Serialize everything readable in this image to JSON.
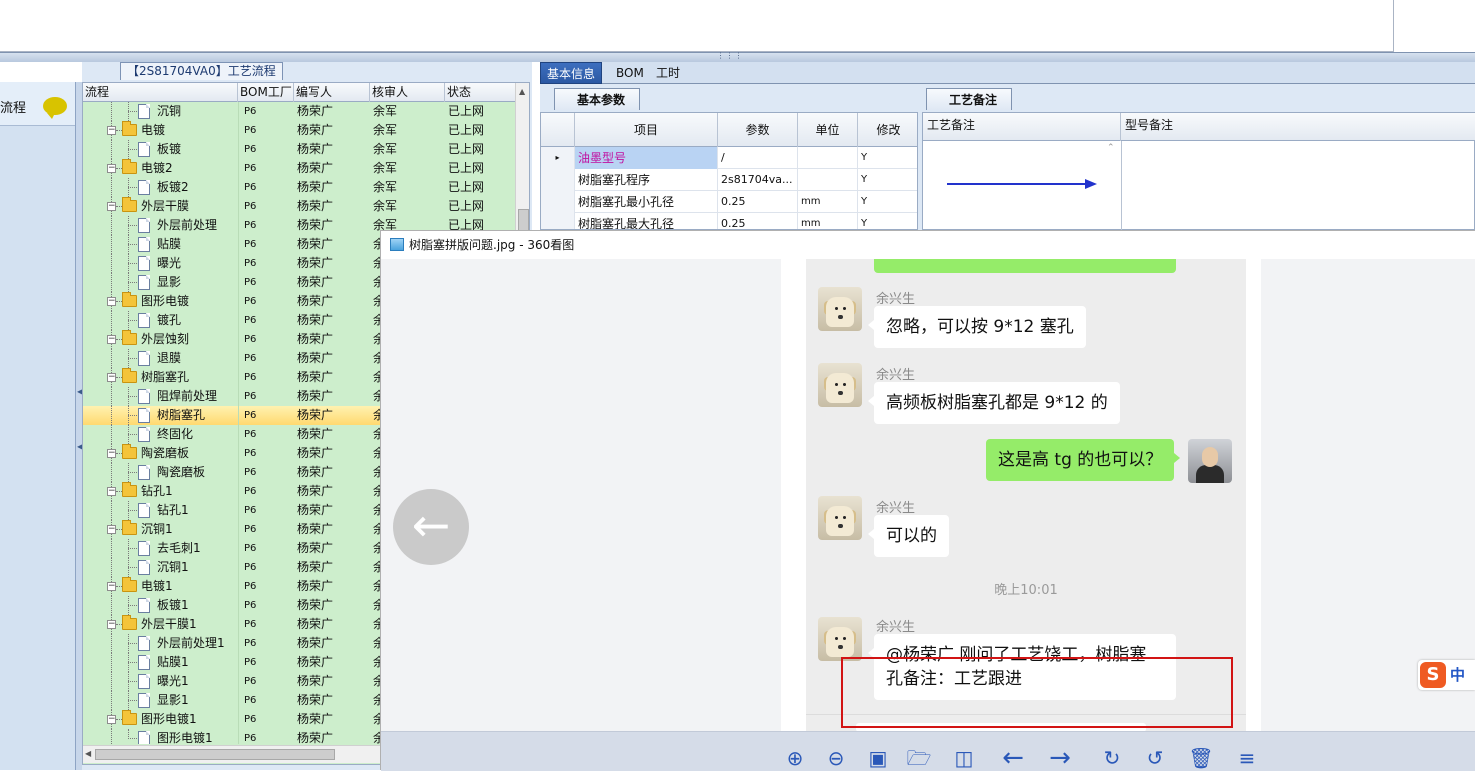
{
  "tree": {
    "title": "【2S81704VA0】工艺流程",
    "columns": [
      "流程",
      "BOM工厂",
      "编写人",
      "核审人",
      "状态"
    ],
    "rows": [
      {
        "level": 2,
        "type": "doc",
        "name": "沉铜",
        "factory": "P6",
        "writer": "杨荣广",
        "reviewer": "余军",
        "status": "已上网"
      },
      {
        "level": 1,
        "type": "folder",
        "name": "电镀",
        "factory": "P6",
        "writer": "杨荣广",
        "reviewer": "余军",
        "status": "已上网"
      },
      {
        "level": 2,
        "type": "doc",
        "name": "板镀",
        "factory": "P6",
        "writer": "杨荣广",
        "reviewer": "余军",
        "status": "已上网"
      },
      {
        "level": 1,
        "type": "folder",
        "name": "电镀2",
        "factory": "P6",
        "writer": "杨荣广",
        "reviewer": "余军",
        "status": "已上网"
      },
      {
        "level": 2,
        "type": "doc",
        "name": "板镀2",
        "factory": "P6",
        "writer": "杨荣广",
        "reviewer": "余军",
        "status": "已上网"
      },
      {
        "level": 1,
        "type": "folder",
        "name": "外层干膜",
        "factory": "P6",
        "writer": "杨荣广",
        "reviewer": "余军",
        "status": "已上网"
      },
      {
        "level": 2,
        "type": "doc",
        "name": "外层前处理",
        "factory": "P6",
        "writer": "杨荣广",
        "reviewer": "余军",
        "status": "已上网"
      },
      {
        "level": 2,
        "type": "doc",
        "name": "贴膜",
        "factory": "P6",
        "writer": "杨荣广",
        "reviewer": "余",
        "status": ""
      },
      {
        "level": 2,
        "type": "doc",
        "name": "曝光",
        "factory": "P6",
        "writer": "杨荣广",
        "reviewer": "余",
        "status": ""
      },
      {
        "level": 2,
        "type": "doc",
        "name": "显影",
        "factory": "P6",
        "writer": "杨荣广",
        "reviewer": "余",
        "status": ""
      },
      {
        "level": 1,
        "type": "folder",
        "name": "图形电镀",
        "factory": "P6",
        "writer": "杨荣广",
        "reviewer": "余",
        "status": ""
      },
      {
        "level": 2,
        "type": "doc",
        "name": "镀孔",
        "factory": "P6",
        "writer": "杨荣广",
        "reviewer": "余",
        "status": ""
      },
      {
        "level": 1,
        "type": "folder",
        "name": "外层蚀刻",
        "factory": "P6",
        "writer": "杨荣广",
        "reviewer": "余",
        "status": ""
      },
      {
        "level": 2,
        "type": "doc",
        "name": "退膜",
        "factory": "P6",
        "writer": "杨荣广",
        "reviewer": "余",
        "status": ""
      },
      {
        "level": 1,
        "type": "folder",
        "name": "树脂塞孔",
        "factory": "P6",
        "writer": "杨荣广",
        "reviewer": "余",
        "status": ""
      },
      {
        "level": 2,
        "type": "doc",
        "name": "阻焊前处理",
        "factory": "P6",
        "writer": "杨荣广",
        "reviewer": "余",
        "status": ""
      },
      {
        "level": 2,
        "type": "doc",
        "name": "树脂塞孔",
        "factory": "P6",
        "writer": "杨荣广",
        "reviewer": "余",
        "status": "",
        "selected": true
      },
      {
        "level": 2,
        "type": "doc",
        "name": "终固化",
        "factory": "P6",
        "writer": "杨荣广",
        "reviewer": "余",
        "status": ""
      },
      {
        "level": 1,
        "type": "folder",
        "name": "陶瓷磨板",
        "factory": "P6",
        "writer": "杨荣广",
        "reviewer": "余",
        "status": ""
      },
      {
        "level": 2,
        "type": "doc",
        "name": "陶瓷磨板",
        "factory": "P6",
        "writer": "杨荣广",
        "reviewer": "余",
        "status": ""
      },
      {
        "level": 1,
        "type": "folder",
        "name": "钻孔1",
        "factory": "P6",
        "writer": "杨荣广",
        "reviewer": "余",
        "status": ""
      },
      {
        "level": 2,
        "type": "doc",
        "name": "钻孔1",
        "factory": "P6",
        "writer": "杨荣广",
        "reviewer": "余",
        "status": ""
      },
      {
        "level": 1,
        "type": "folder",
        "name": "沉铜1",
        "factory": "P6",
        "writer": "杨荣广",
        "reviewer": "余",
        "status": ""
      },
      {
        "level": 2,
        "type": "doc",
        "name": "去毛刺1",
        "factory": "P6",
        "writer": "杨荣广",
        "reviewer": "余",
        "status": ""
      },
      {
        "level": 2,
        "type": "doc",
        "name": "沉铜1",
        "factory": "P6",
        "writer": "杨荣广",
        "reviewer": "余",
        "status": ""
      },
      {
        "level": 1,
        "type": "folder",
        "name": "电镀1",
        "factory": "P6",
        "writer": "杨荣广",
        "reviewer": "余",
        "status": ""
      },
      {
        "level": 2,
        "type": "doc",
        "name": "板镀1",
        "factory": "P6",
        "writer": "杨荣广",
        "reviewer": "余",
        "status": ""
      },
      {
        "level": 1,
        "type": "folder",
        "name": "外层干膜1",
        "factory": "P6",
        "writer": "杨荣广",
        "reviewer": "余",
        "status": ""
      },
      {
        "level": 2,
        "type": "doc",
        "name": "外层前处理1",
        "factory": "P6",
        "writer": "杨荣广",
        "reviewer": "余",
        "status": ""
      },
      {
        "level": 2,
        "type": "doc",
        "name": "贴膜1",
        "factory": "P6",
        "writer": "杨荣广",
        "reviewer": "余",
        "status": ""
      },
      {
        "level": 2,
        "type": "doc",
        "name": "曝光1",
        "factory": "P6",
        "writer": "杨荣广",
        "reviewer": "余",
        "status": ""
      },
      {
        "level": 2,
        "type": "doc",
        "name": "显影1",
        "factory": "P6",
        "writer": "杨荣广",
        "reviewer": "余",
        "status": ""
      },
      {
        "level": 1,
        "type": "folder",
        "name": "图形电镀1",
        "factory": "P6",
        "writer": "杨荣广",
        "reviewer": "余",
        "status": ""
      },
      {
        "level": 2,
        "type": "doc",
        "name": "图形电镀1",
        "factory": "P6",
        "writer": "杨荣广",
        "reviewer": "余",
        "status": ""
      }
    ]
  },
  "leftnav": {
    "label": "流程",
    "icon": "chat-bubble-icon"
  },
  "tabs": [
    "基本信息",
    "BOM",
    "工时"
  ],
  "basic": {
    "title": "基本参数",
    "columns": [
      "项目",
      "参数",
      "单位",
      "修改"
    ],
    "rows": [
      {
        "item": "油墨型号",
        "param": "/",
        "unit": "",
        "mod": "Y",
        "current": true
      },
      {
        "item": "树脂塞孔程序",
        "param": "2s81704va...",
        "unit": "",
        "mod": "Y"
      },
      {
        "item": "树脂塞孔最小孔径",
        "param": "0.25",
        "unit": "mm",
        "mod": "Y"
      },
      {
        "item": "树脂塞孔最大孔径",
        "param": "0.25",
        "unit": "mm",
        "mod": "Y"
      }
    ]
  },
  "remarks": {
    "title": "工艺备注",
    "columns": [
      "工艺备注",
      "型号备注"
    ]
  },
  "viewer": {
    "title": "树脂塞拼版问题.jpg - 360看图",
    "messages": [
      {
        "side": "left",
        "sender": "余兴生",
        "text": "忽略，可以按 9*12 塞孔"
      },
      {
        "side": "left",
        "sender": "余兴生",
        "text": "高频板树脂塞孔都是 9*12 的"
      },
      {
        "side": "right",
        "text": "这是高 tg 的也可以？"
      },
      {
        "side": "left",
        "sender": "余兴生",
        "text": "可以的"
      },
      {
        "side": "left",
        "sender": "余兴生",
        "text_line1": "@杨荣广 刚问了工艺饶工，树脂塞",
        "text_line2": "孔备注：工艺跟进"
      }
    ],
    "timestamp": "晚上10:01",
    "toolbar": [
      "zoom-in-icon",
      "zoom-out-icon",
      "fit-icon",
      "open-folder-icon",
      "slideshow-icon",
      "prev-arrow-icon",
      "next-arrow-icon",
      "rotate-right-icon",
      "rotate-left-icon",
      "delete-icon",
      "menu-icon"
    ]
  },
  "ime": {
    "label": "中"
  }
}
